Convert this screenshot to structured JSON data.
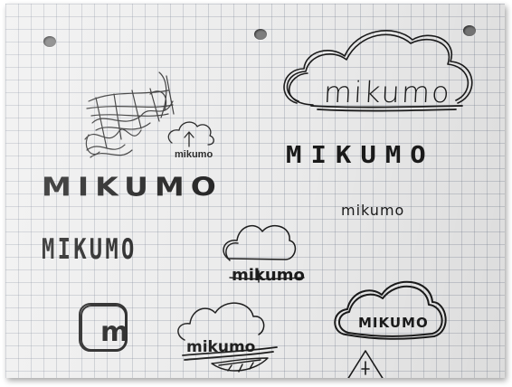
{
  "photo": {
    "subject": "sketchbook-page-logo-drafts",
    "paper_color": "#efefef",
    "grid_color": "#8c96aa",
    "ink_color": "#1b1b1b"
  },
  "sketches": {
    "cloud_wordmark_large": "mikumo",
    "tiny_cloud_wordmark": "mikumo",
    "caps_wordmark_left": "MIKUMO",
    "caps_wordmark_right": "MIKUMO",
    "small_lowercase_wordmark": "mikumo",
    "striped_wordmark": "MIKUMO",
    "cloud_wordmark_middle": "mikumo",
    "m_icon_letter": "m",
    "cloud_wordmark_lower": "mikumo",
    "caps_in_cloud": "MIKUMO"
  }
}
